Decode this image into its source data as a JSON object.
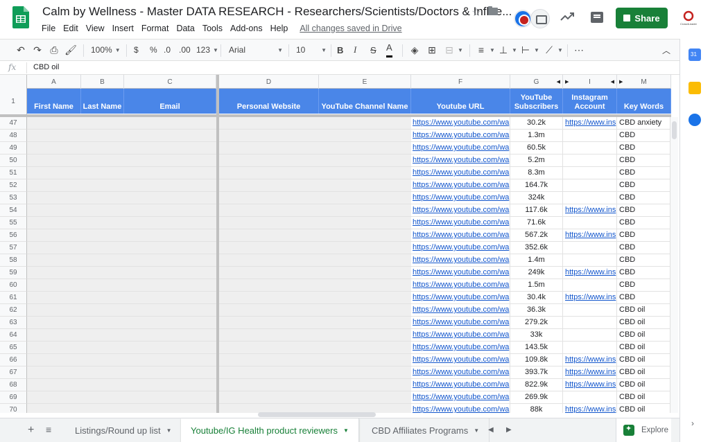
{
  "title": "Calm by Wellness - Master DATA RESEARCH - Researchers/Scientists/Doctors & Influe...",
  "menu": [
    "File",
    "Edit",
    "View",
    "Insert",
    "Format",
    "Data",
    "Tools",
    "Add-ons",
    "Help"
  ],
  "saved_status": "All changes saved in Drive",
  "share_label": "Share",
  "brand_text": "CrowdLeader",
  "toolbar": {
    "zoom": "100%",
    "currency": "$",
    "percent": "%",
    "dec_less": ".0",
    "dec_more": ".00",
    "more_formats": "123",
    "font": "Arial",
    "font_size": "10",
    "bold": "B",
    "italic": "I",
    "strike": "S",
    "text_color": "A",
    "more": "⋯"
  },
  "formula_bar": {
    "fx": "fx",
    "value": "CBD oil"
  },
  "columns": [
    "A",
    "B",
    "C",
    "D",
    "E",
    "F",
    "G",
    "I",
    "M"
  ],
  "header_row_number": "1",
  "headers": {
    "first_name": "First Name",
    "last_name": "Last Name",
    "email": "Email",
    "personal_website": "Personal Website",
    "youtube_channel_name": "YouTube Channel Name",
    "youtube_url": "Youtube URL",
    "youtube_subscribers": "YouTube Subscribers",
    "instagram_account": "Instagram Account",
    "key_words": "Key Words"
  },
  "rows": [
    {
      "n": "47",
      "url": "https://www.youtube.com/wa",
      "subs": "30.2k",
      "ig": "https://www.ins",
      "kw": "CBD anxiety"
    },
    {
      "n": "48",
      "url": "https://www.youtube.com/wa",
      "subs": "1.3m",
      "ig": "",
      "kw": "CBD"
    },
    {
      "n": "49",
      "url": "https://www.youtube.com/wa",
      "subs": "60.5k",
      "ig": "",
      "kw": "CBD"
    },
    {
      "n": "50",
      "url": "https://www.youtube.com/wa",
      "subs": "5.2m",
      "ig": "",
      "kw": "CBD"
    },
    {
      "n": "51",
      "url": "https://www.youtube.com/wa",
      "subs": "8.3m",
      "ig": "",
      "kw": "CBD"
    },
    {
      "n": "52",
      "url": "https://www.youtube.com/wa",
      "subs": "164.7k",
      "ig": "",
      "kw": "CBD"
    },
    {
      "n": "53",
      "url": "https://www.youtube.com/wa",
      "subs": "324k",
      "ig": "",
      "kw": "CBD"
    },
    {
      "n": "54",
      "url": "https://www.youtube.com/wa",
      "subs": "117.6k",
      "ig": "https://www.ins",
      "kw": "CBD"
    },
    {
      "n": "55",
      "url": "https://www.youtube.com/wa",
      "subs": "71.6k",
      "ig": "",
      "kw": "CBD"
    },
    {
      "n": "56",
      "url": "https://www.youtube.com/wa",
      "subs": "567.2k",
      "ig": "https://www.ins",
      "kw": "CBD"
    },
    {
      "n": "57",
      "url": "https://www.youtube.com/wa",
      "subs": "352.6k",
      "ig": "",
      "kw": "CBD"
    },
    {
      "n": "58",
      "url": "https://www.youtube.com/wa",
      "subs": "1.4m",
      "ig": "",
      "kw": "CBD"
    },
    {
      "n": "59",
      "url": "https://www.youtube.com/wa",
      "subs": "249k",
      "ig": "https://www.ins",
      "kw": "CBD"
    },
    {
      "n": "60",
      "url": "https://www.youtube.com/wa",
      "subs": "1.5m",
      "ig": "",
      "kw": "CBD"
    },
    {
      "n": "61",
      "url": "https://www.youtube.com/wa",
      "subs": "30.4k",
      "ig": "https://www.ins",
      "kw": "CBD"
    },
    {
      "n": "62",
      "url": "https://www.youtube.com/wa",
      "subs": "36.3k",
      "ig": "",
      "kw": "CBD oil"
    },
    {
      "n": "63",
      "url": "https://www.youtube.com/wa",
      "subs": "279.2k",
      "ig": "",
      "kw": "CBD oil"
    },
    {
      "n": "64",
      "url": "https://www.youtube.com/wa",
      "subs": "33k",
      "ig": "",
      "kw": "CBD oil"
    },
    {
      "n": "65",
      "url": "https://www.youtube.com/wa",
      "subs": "143.5k",
      "ig": "",
      "kw": "CBD oil"
    },
    {
      "n": "66",
      "url": "https://www.youtube.com/wa",
      "subs": "109.8k",
      "ig": "https://www.ins",
      "kw": "CBD oil"
    },
    {
      "n": "67",
      "url": "https://www.youtube.com/wa",
      "subs": "393.7k",
      "ig": "https://www.ins",
      "kw": "CBD oil"
    },
    {
      "n": "68",
      "url": "https://www.youtube.com/wa",
      "subs": "822.9k",
      "ig": "https://www.ins",
      "kw": "CBD oil"
    },
    {
      "n": "69",
      "url": "https://www.youtube.com/wa",
      "subs": "269.9k",
      "ig": "",
      "kw": "CBD oil"
    },
    {
      "n": "70",
      "url": "https://www.youtube.com/wa",
      "subs": "88k",
      "ig": "https://www.ins",
      "kw": "CBD oil"
    }
  ],
  "sheet_tabs": [
    {
      "label": "Listings/Round up list",
      "active": false
    },
    {
      "label": "Youtube/IG Health product reviewers",
      "active": true
    },
    {
      "label": "CBD Affiliates Programs",
      "active": false
    }
  ],
  "explore_label": "Explore",
  "colors": {
    "header_blue": "#4a86e8",
    "link_blue": "#1155cc",
    "share_green": "#188038"
  }
}
